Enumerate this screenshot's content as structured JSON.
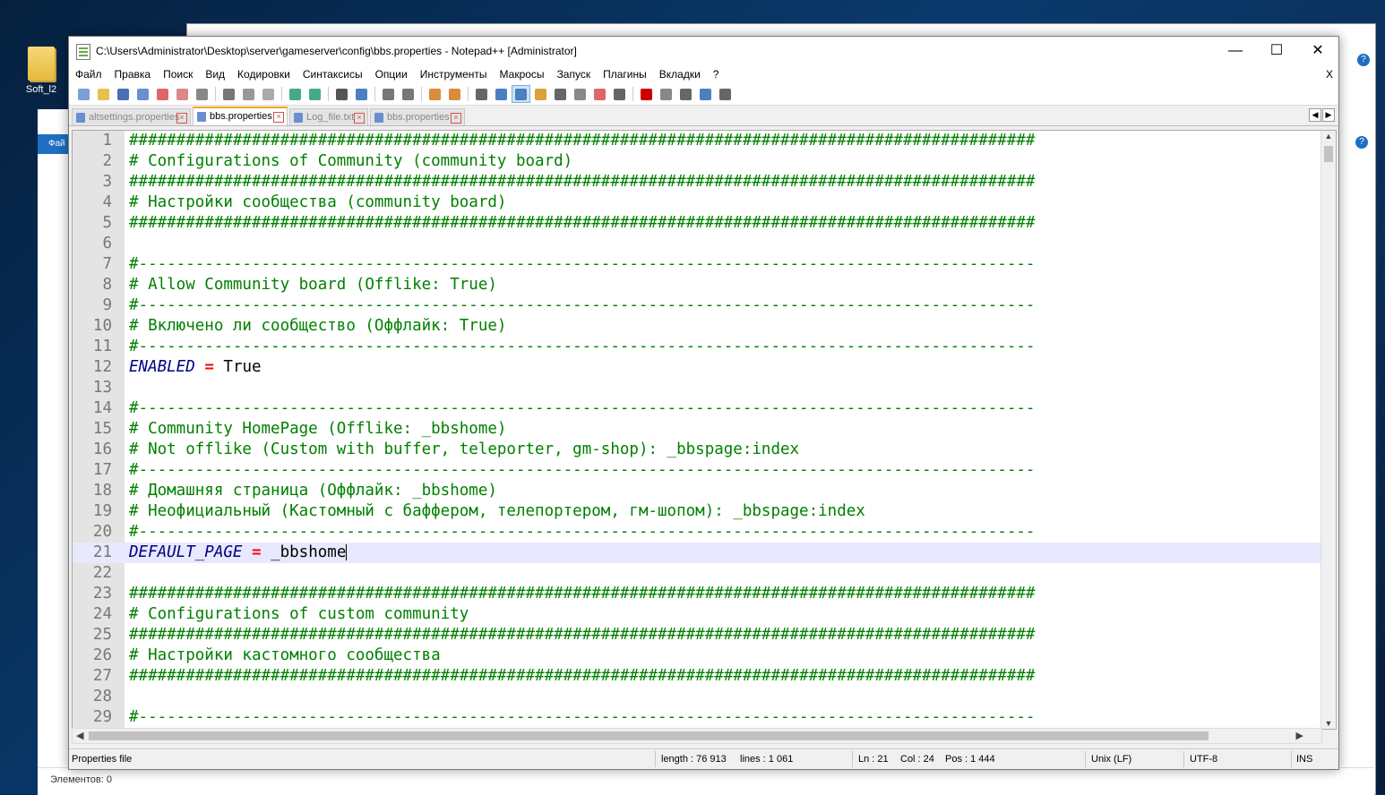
{
  "desktop": {
    "icon_label": "Soft_l2",
    "explorer_status": "Элементов: 0",
    "explorer_menu_label": "Фай"
  },
  "window": {
    "title": "C:\\Users\\Administrator\\Desktop\\server\\gameserver\\config\\bbs.properties - Notepad++ [Administrator]",
    "minimize": "—",
    "maximize": "☐",
    "close": "✕"
  },
  "menu": {
    "items": [
      "Файл",
      "Правка",
      "Поиск",
      "Вид",
      "Кодировки",
      "Синтаксисы",
      "Опции",
      "Инструменты",
      "Макросы",
      "Запуск",
      "Плагины",
      "Вкладки",
      "?"
    ],
    "close": "X"
  },
  "toolbar": {
    "icons": [
      "new-file-icon",
      "open-file-icon",
      "save-icon",
      "save-all-icon",
      "close-icon",
      "close-all-icon",
      "print-icon",
      "cut-icon",
      "copy-icon",
      "paste-icon",
      "undo-icon",
      "redo-icon",
      "find-icon",
      "replace-icon",
      "zoom-in-icon",
      "zoom-out-icon",
      "sync-vertical-icon",
      "sync-horizontal-icon",
      "word-wrap-icon",
      "show-all-chars-icon",
      "indent-guide-icon",
      "user-language-icon",
      "doc-map-icon",
      "function-list-icon",
      "folder-workspace-icon",
      "monitoring-icon",
      "record-macro-icon",
      "stop-macro-icon",
      "play-macro-icon",
      "run-macro-multiple-icon",
      "save-macro-icon"
    ],
    "active_index": 20
  },
  "tabs": [
    {
      "label": "altsettings.properties",
      "active": false
    },
    {
      "label": "bbs.properties",
      "active": true
    },
    {
      "label": "Log_file.txt",
      "active": false
    },
    {
      "label": "bbs.properties",
      "active": false
    }
  ],
  "editor": {
    "current_line": 21,
    "lines": [
      {
        "n": "1",
        "type": "comment",
        "text": "################################################################################################"
      },
      {
        "n": "2",
        "type": "comment",
        "text": "# Configurations of Community (community board)"
      },
      {
        "n": "3",
        "type": "comment",
        "text": "################################################################################################"
      },
      {
        "n": "4",
        "type": "comment",
        "text": "# Настройки сообщества (community board)"
      },
      {
        "n": "5",
        "type": "comment",
        "text": "################################################################################################"
      },
      {
        "n": "6",
        "type": "blank",
        "text": ""
      },
      {
        "n": "7",
        "type": "comment",
        "text": "#-----------------------------------------------------------------------------------------------"
      },
      {
        "n": "8",
        "type": "comment",
        "text": "# Allow Community board (Offlike: True)"
      },
      {
        "n": "9",
        "type": "comment",
        "text": "#-----------------------------------------------------------------------------------------------"
      },
      {
        "n": "10",
        "type": "comment",
        "text": "# Включено ли сообщество (Оффлайк: True)"
      },
      {
        "n": "11",
        "type": "comment",
        "text": "#-----------------------------------------------------------------------------------------------"
      },
      {
        "n": "12",
        "type": "kv",
        "key": "ENABLED",
        "eq": "=",
        "value": "True"
      },
      {
        "n": "13",
        "type": "blank",
        "text": ""
      },
      {
        "n": "14",
        "type": "comment",
        "text": "#-----------------------------------------------------------------------------------------------"
      },
      {
        "n": "15",
        "type": "comment",
        "text": "# Community HomePage (Offlike: _bbshome)"
      },
      {
        "n": "16",
        "type": "comment",
        "text": "# Not offlike (Custom with buffer, teleporter, gm-shop): _bbspage:index"
      },
      {
        "n": "17",
        "type": "comment",
        "text": "#-----------------------------------------------------------------------------------------------"
      },
      {
        "n": "18",
        "type": "comment",
        "text": "# Домашняя страница (Оффлайк: _bbshome)"
      },
      {
        "n": "19",
        "type": "comment",
        "text": "# Неофициальный (Кастомный с баффером, телепортером, гм-шопом): _bbspage:index"
      },
      {
        "n": "20",
        "type": "comment",
        "text": "#-----------------------------------------------------------------------------------------------"
      },
      {
        "n": "21",
        "type": "kv",
        "key": "DEFAULT_PAGE",
        "eq": "=",
        "value": "_bbshome"
      },
      {
        "n": "22",
        "type": "blank",
        "text": ""
      },
      {
        "n": "23",
        "type": "comment",
        "text": "################################################################################################"
      },
      {
        "n": "24",
        "type": "comment",
        "text": "# Configurations of custom community"
      },
      {
        "n": "25",
        "type": "comment",
        "text": "################################################################################################"
      },
      {
        "n": "26",
        "type": "comment",
        "text": "# Настройки кастомного сообщества"
      },
      {
        "n": "27",
        "type": "comment",
        "text": "################################################################################################"
      },
      {
        "n": "28",
        "type": "blank",
        "text": ""
      },
      {
        "n": "29",
        "type": "comment",
        "text": "#-----------------------------------------------------------------------------------------------"
      }
    ]
  },
  "status": {
    "file_type": "Properties file",
    "length": "length : 76 913",
    "lines": "lines : 1 061",
    "ln": "Ln : 21",
    "col": "Col : 24",
    "pos": "Pos : 1 444",
    "eol": "Unix (LF)",
    "encoding": "UTF-8",
    "mode": "INS"
  },
  "colors": {
    "comment": "#008000",
    "key": "#000080",
    "operator": "#ff0000",
    "current_line_bg": "#e8e8ff",
    "active_tab_accent": "#f5a623"
  }
}
